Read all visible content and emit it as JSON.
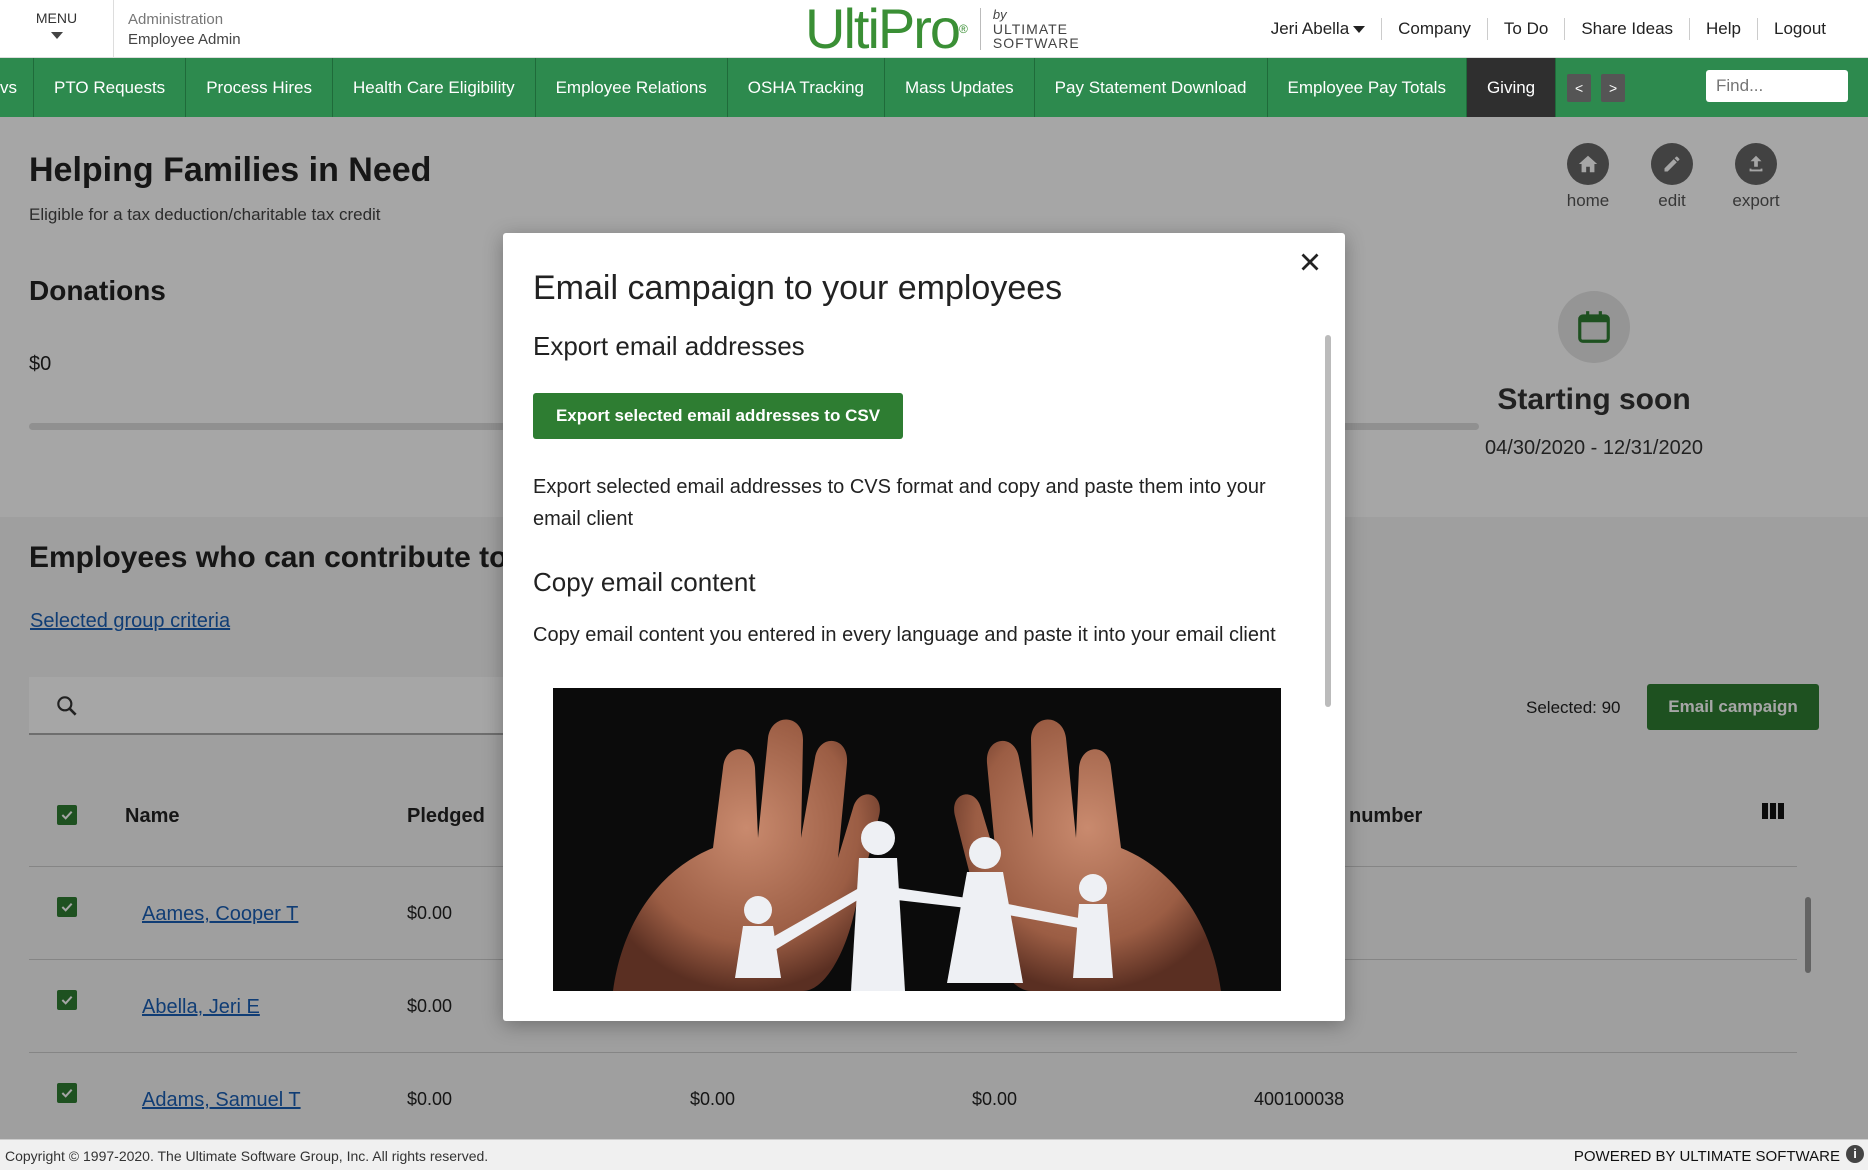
{
  "header": {
    "menu_label": "MENU",
    "admin_label": "Administration",
    "admin_sub": "Employee Admin",
    "logo_text": "UltiPro",
    "logo_by": "by",
    "logo_company_1": "ULTIMATE",
    "logo_company_2": "SOFTWARE",
    "user": "Jeri Abella",
    "links": [
      "Company",
      "To Do",
      "Share Ideas",
      "Help",
      "Logout"
    ]
  },
  "nav": {
    "items": [
      "vs",
      "PTO Requests",
      "Process Hires",
      "Health Care Eligibility",
      "Employee Relations",
      "OSHA Tracking",
      "Mass Updates",
      "Pay Statement Download",
      "Employee Pay Totals",
      "Giving"
    ],
    "active": "Giving",
    "prev": "<",
    "next": ">",
    "find_placeholder": "Find..."
  },
  "page": {
    "title": "Helping Families in Need",
    "subtitle": "Eligible for a tax deduction/charitable tax credit",
    "actions": [
      "home",
      "edit",
      "export"
    ],
    "donations_title": "Donations",
    "donations_value": "$0",
    "status": "Starting soon",
    "date_range": "04/30/2020 - 12/31/2020",
    "employees_title": "Employees who can contribute to this campaign",
    "group_criteria_link": "Selected group criteria",
    "selected_label": "Selected: 90",
    "email_campaign_button": "Email campaign",
    "table": {
      "headers": [
        "Name",
        "Pledged",
        "number"
      ],
      "rows": [
        {
          "name": "Aames, Cooper T",
          "pledged": "$0.00",
          "c3": "",
          "c4": "",
          "number": ""
        },
        {
          "name": "Abella, Jeri E",
          "pledged": "$0.00",
          "c3": "",
          "c4": "",
          "number": ""
        },
        {
          "name": "Adams, Samuel T",
          "pledged": "$0.00",
          "c3": "$0.00",
          "c4": "$0.00",
          "number": "400100038"
        }
      ]
    }
  },
  "modal": {
    "title": "Email campaign to your employees",
    "export_heading": "Export email addresses",
    "export_button": "Export selected email addresses to CSV",
    "export_desc": "Export selected email addresses to CVS format and copy and paste them into your email client",
    "copy_heading": "Copy email content",
    "copy_desc": "Copy email content you entered in every language and paste it into your email client"
  },
  "footer": {
    "copyright": "Copyright © 1997-2020. The Ultimate Software Group, Inc. All rights reserved.",
    "powered": "POWERED BY ULTIMATE SOFTWARE",
    "info": "i"
  },
  "colors": {
    "brand_green": "#2d8a4e",
    "button_green": "#2e7d32",
    "link_blue": "#1a5fb4",
    "nav_active": "#2f2f2f"
  }
}
